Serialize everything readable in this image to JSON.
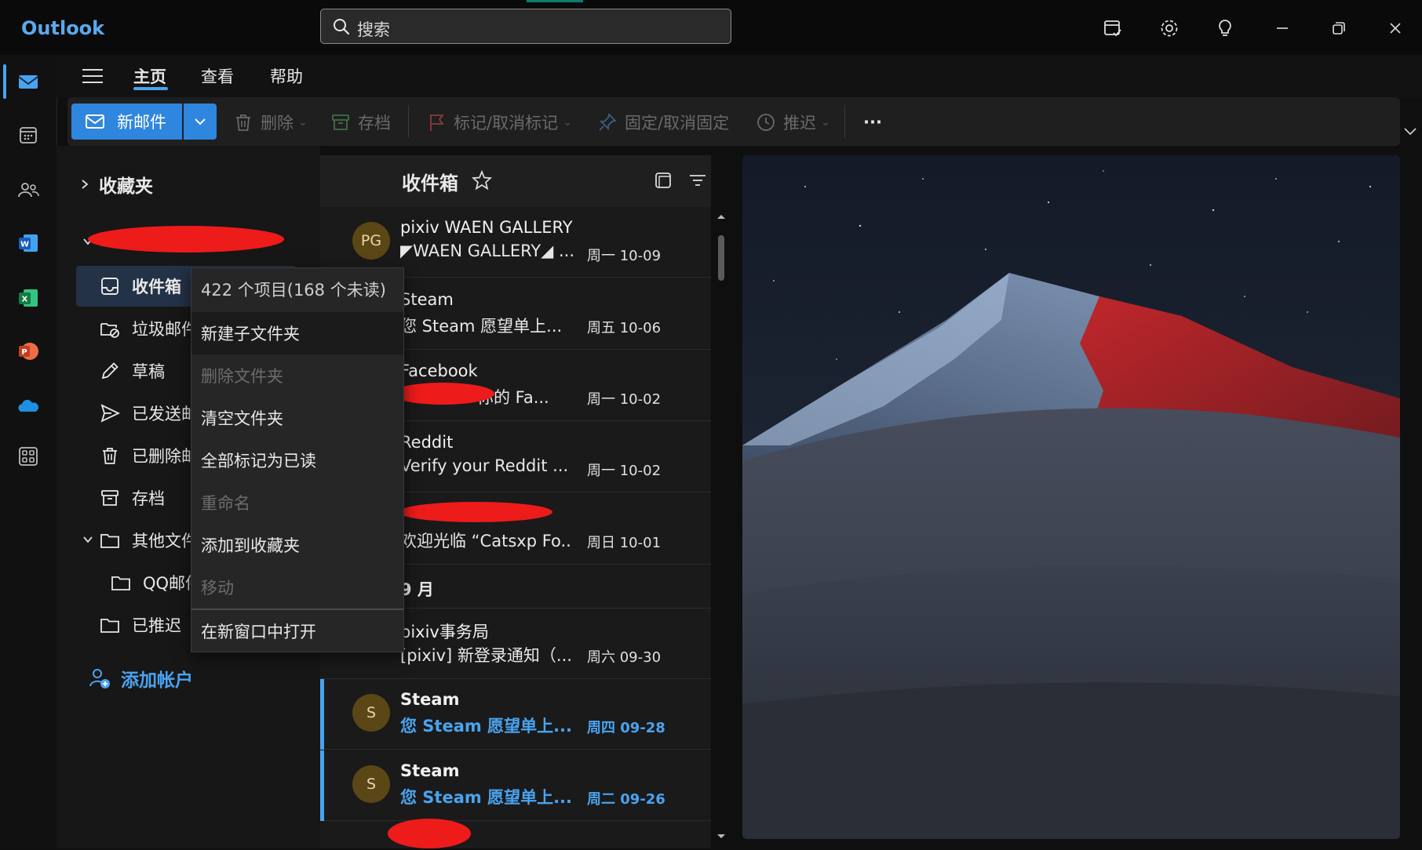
{
  "app": {
    "title": "Outlook"
  },
  "search": {
    "placeholder": "搜索"
  },
  "titlebar_icons": [
    "calendar-check-icon",
    "gear-icon",
    "lightbulb-icon",
    "minimize-icon",
    "restore-icon",
    "close-icon"
  ],
  "rail": {
    "items": [
      "mail-icon",
      "calendar-icon",
      "people-icon",
      "word-icon",
      "excel-icon",
      "powerpoint-icon",
      "onedrive-icon",
      "apps-icon"
    ]
  },
  "menu": {
    "tabs": [
      "主页",
      "查看",
      "帮助"
    ],
    "active": "主页"
  },
  "ribbon": {
    "new_mail": "新邮件",
    "delete": "删除",
    "archive": "存档",
    "flag": "标记/取消标记",
    "pin": "固定/取消固定",
    "snooze": "推迟",
    "more": "···"
  },
  "folders": {
    "favorites": "收藏夹",
    "inbox": "收件箱",
    "junk": "垃圾邮件",
    "drafts": "草稿",
    "sent": "已发送邮件",
    "deleted": "已删除邮件",
    "archive": "存档",
    "other": "其他文件夹",
    "qq": "QQ邮件",
    "snoozed": "已推迟",
    "add_account": "添加帐户"
  },
  "list": {
    "title": "收件箱",
    "group_label": "9 月",
    "messages": [
      {
        "initials": "PG",
        "sender": "pixiv WAEN GALLERY",
        "subject": "◤WAEN GALLERY◢ ...",
        "date": "周一 10-09",
        "unread": false
      },
      {
        "initials": "",
        "sender": "Steam",
        "subject": "您 Steam 愿望单上...",
        "date": "周五 10-06",
        "unread": false
      },
      {
        "initials": "",
        "sender": "Facebook",
        "subject": "你的 Fa...",
        "date": "周一 10-02",
        "unread": false
      },
      {
        "initials": "",
        "sender": "Reddit",
        "subject": "Verify your Reddit ...",
        "date": "周一 10-02",
        "unread": false
      },
      {
        "initials": "",
        "sender": "",
        "subject": "欢迎光临 “Catsxp Fo...",
        "date": "周日 10-01",
        "unread": false
      },
      {
        "initials": "",
        "sender": "pixiv事务局",
        "subject": "[pixiv] 新登录通知（...",
        "date": "周六 09-30",
        "unread": false
      },
      {
        "initials": "S",
        "sender": "Steam",
        "subject": "您 Steam 愿望单上...",
        "date": "周四 09-28",
        "unread": true
      },
      {
        "initials": "S",
        "sender": "Steam",
        "subject": "您 Steam 愿望单上...",
        "date": "周二 09-26",
        "unread": true
      }
    ]
  },
  "context_menu": {
    "info": "422 个项目(168 个未读)",
    "items": [
      {
        "label": "新建子文件夹",
        "disabled": false
      },
      {
        "label": "删除文件夹",
        "disabled": true
      },
      {
        "label": "清空文件夹",
        "disabled": false
      },
      {
        "label": "全部标记为已读",
        "disabled": false
      },
      {
        "label": "重命名",
        "disabled": true
      },
      {
        "label": "添加到收藏夹",
        "disabled": false
      },
      {
        "label": "移动",
        "disabled": true
      },
      {
        "label": "在新窗口中打开",
        "disabled": false
      }
    ]
  },
  "colors": {
    "accent": "#2f86de",
    "link": "#4aa3f0",
    "redaction": "#ee1b1b",
    "mountain_red": "#b0262a"
  }
}
